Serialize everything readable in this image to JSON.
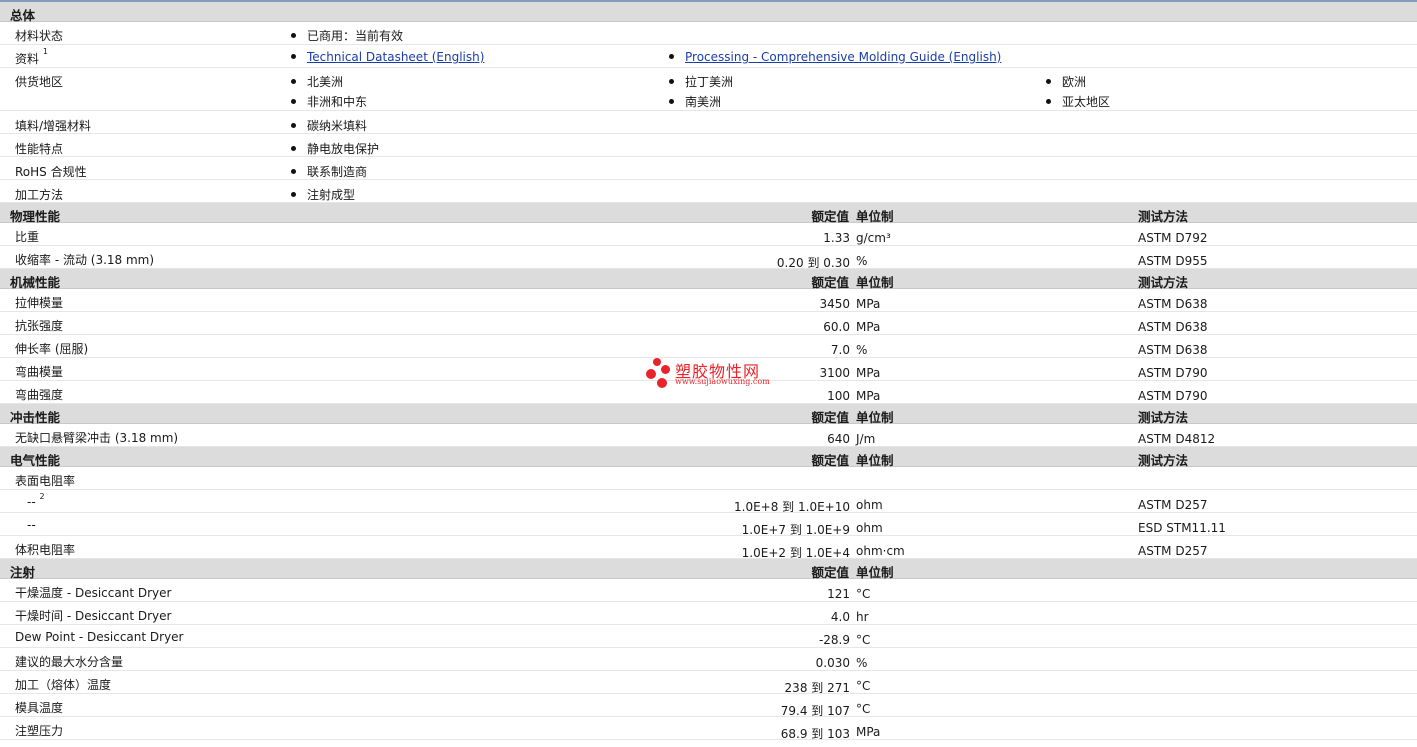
{
  "general": {
    "title": "总体",
    "status": {
      "label": "材料状态",
      "value": "已商用：当前有效"
    },
    "docs": {
      "label": "资料",
      "sup": "1",
      "links": [
        "Technical Datasheet (English)",
        "Processing - Comprehensive Molding Guide (English)"
      ]
    },
    "regions": {
      "label": "供货地区",
      "items": [
        "北美洲",
        "拉丁美洲",
        "欧洲",
        "非洲和中东",
        "南美洲",
        "亚太地区"
      ]
    },
    "filler": {
      "label": "填料/增强材料",
      "value": "碳纳米填料"
    },
    "features": {
      "label": "性能特点",
      "value": "静电放电保护"
    },
    "rohs": {
      "label": "RoHS 合规性",
      "value": "联系制造商"
    },
    "processing": {
      "label": "加工方法",
      "value": "注射成型"
    }
  },
  "physical": {
    "title": "物理性能",
    "col_value": "额定值",
    "col_unit": "单位制",
    "col_method": "测试方法",
    "rows": [
      {
        "label": "比重",
        "value": "1.33",
        "unit": "g/cm³",
        "method": "ASTM D792"
      },
      {
        "label": "收缩率 - 流动  (3.18 mm)",
        "value": "0.20 到  0.30",
        "unit": "%",
        "method": "ASTM D955"
      }
    ]
  },
  "mechanical": {
    "title": "机械性能",
    "col_value": "额定值",
    "col_unit": "单位制",
    "col_method": "测试方法",
    "rows": [
      {
        "label": "拉伸模量",
        "value": "3450",
        "unit": "MPa",
        "method": "ASTM D638"
      },
      {
        "label": "抗张强度",
        "value": "60.0",
        "unit": "MPa",
        "method": "ASTM D638"
      },
      {
        "label": "伸长率  (屈服)",
        "value": "7.0",
        "unit": "%",
        "method": "ASTM D638"
      },
      {
        "label": "弯曲模量",
        "value": "3100",
        "unit": "MPa",
        "method": "ASTM D790"
      },
      {
        "label": "弯曲强度",
        "value": "100",
        "unit": "MPa",
        "method": "ASTM D790"
      }
    ]
  },
  "impact": {
    "title": "冲击性能",
    "col_value": "额定值",
    "col_unit": "单位制",
    "col_method": "测试方法",
    "rows": [
      {
        "label": "无缺口悬臂梁冲击  (3.18 mm)",
        "value": "640",
        "unit": "J/m",
        "method": "ASTM D4812"
      }
    ]
  },
  "electrical": {
    "title": "电气性能",
    "col_value": "额定值",
    "col_unit": "单位制",
    "col_method": "测试方法",
    "surface_label": "表面电阻率",
    "rows": [
      {
        "label": "--",
        "sup": "2",
        "value": "1.0E+8 到  1.0E+10",
        "unit": "ohm",
        "method": "ASTM D257"
      },
      {
        "label": "--",
        "value": "1.0E+7 到  1.0E+9",
        "unit": "ohm",
        "method": "ESD STM11.11"
      }
    ],
    "volume": {
      "label": "体积电阻率",
      "value": "1.0E+2 到  1.0E+4",
      "unit": "ohm·cm",
      "method": "ASTM D257"
    }
  },
  "injection": {
    "title": "注射",
    "col_value": "额定值",
    "col_unit": "单位制",
    "rows": [
      {
        "label": "干燥温度  - Desiccant Dryer",
        "value": "121",
        "unit": "°C"
      },
      {
        "label": "干燥时间  - Desiccant Dryer",
        "value": "4.0",
        "unit": "hr"
      },
      {
        "label": "Dew Point - Desiccant Dryer",
        "value": "-28.9",
        "unit": "°C"
      },
      {
        "label": "建议的最大水分含量",
        "value": "0.030",
        "unit": "%"
      },
      {
        "label": "加工（熔体）温度",
        "value": "238 到  271",
        "unit": "°C"
      },
      {
        "label": "模具温度",
        "value": "79.4 到  107",
        "unit": "°C"
      },
      {
        "label": "注塑压力",
        "value": "68.9 到  103",
        "unit": "MPa"
      }
    ]
  },
  "watermark": {
    "name": "塑胶物性网",
    "url": "www.sujiaowuxing.com",
    "color": "#e8242a"
  }
}
